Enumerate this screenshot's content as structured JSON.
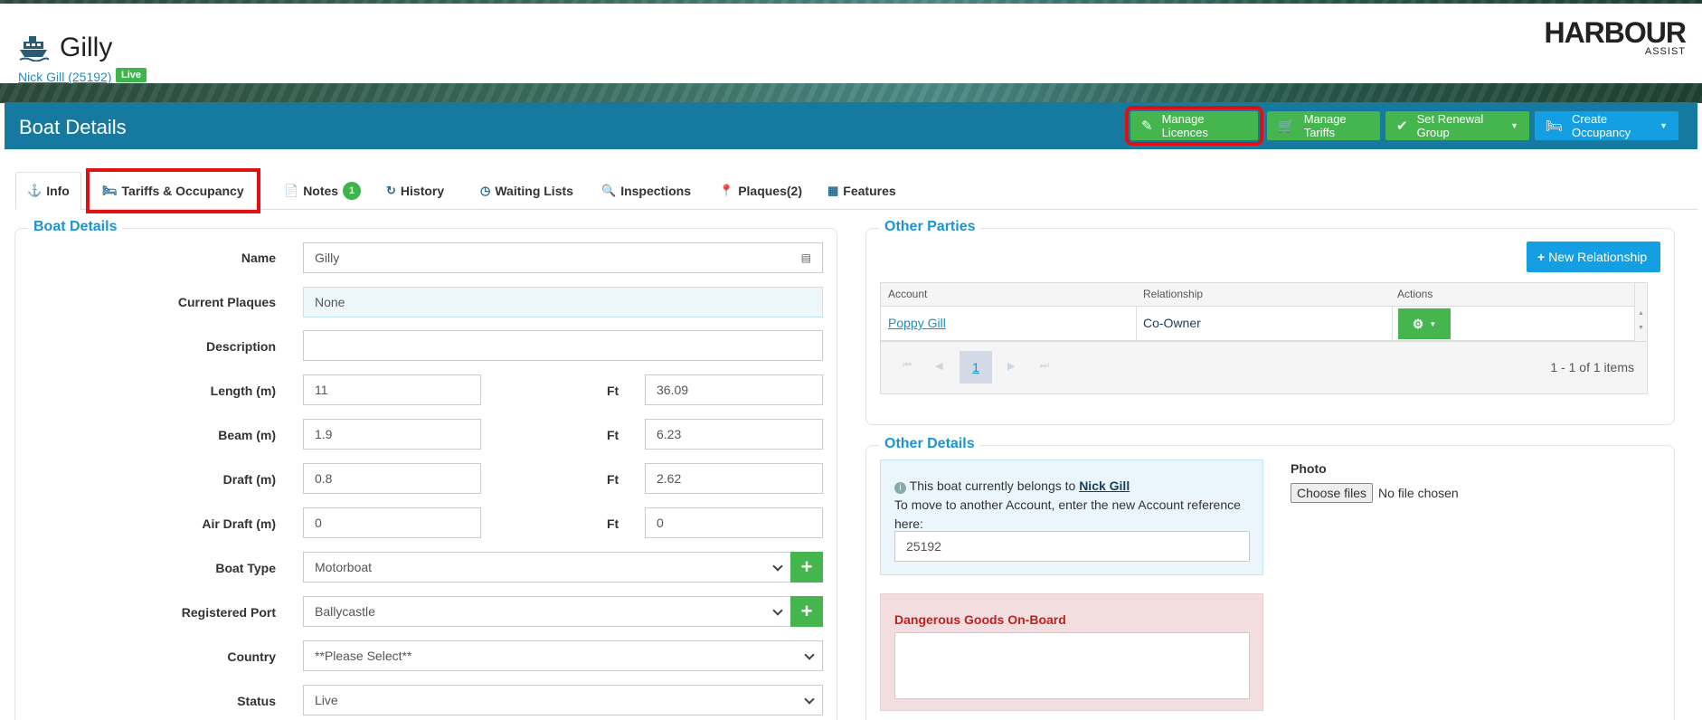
{
  "header": {
    "title": "Gilly",
    "owner_link": "Nick Gill (25192)",
    "status_badge": "Live",
    "logo_main": "HARBOUR",
    "logo_sub": "ASSIST"
  },
  "toolbar": {
    "title": "Boat Details",
    "buttons": [
      {
        "label": "Manage Licences"
      },
      {
        "label": "Manage Tariffs"
      },
      {
        "label": "Set Renewal Group"
      },
      {
        "label": "Create Occupancy"
      }
    ]
  },
  "tabs": [
    {
      "label": "Info"
    },
    {
      "label": "Tariffs & Occupancy"
    },
    {
      "label": "Notes",
      "count": "1"
    },
    {
      "label": "History"
    },
    {
      "label": "Waiting Lists"
    },
    {
      "label": "Inspections"
    },
    {
      "label": "Plaques(2)"
    },
    {
      "label": "Features"
    }
  ],
  "boat_details": {
    "legend": "Boat Details",
    "name_label": "Name",
    "name_value": "Gilly",
    "plaques_label": "Current Plaques",
    "plaques_value": "None",
    "description_label": "Description",
    "description_value": "",
    "length_label": "Length (m)",
    "length_m": "11",
    "length_ft": "36.09",
    "beam_label": "Beam (m)",
    "beam_m": "1.9",
    "beam_ft": "6.23",
    "draft_label": "Draft (m)",
    "draft_m": "0.8",
    "draft_ft": "2.62",
    "air_draft_label": "Air Draft (m)",
    "air_draft_m": "0",
    "air_draft_ft": "0",
    "ft_label": "Ft",
    "boat_type_label": "Boat Type",
    "boat_type_value": "Motorboat",
    "port_label": "Registered Port",
    "port_value": "Ballycastle",
    "country_label": "Country",
    "country_value": "**Please Select**",
    "status_label": "Status",
    "status_value": "Live"
  },
  "other_parties": {
    "legend": "Other Parties",
    "new_button": "New Relationship",
    "columns": [
      "Account",
      "Relationship",
      "Actions"
    ],
    "rows": [
      {
        "account": "Poppy Gill",
        "relationship": "Co-Owner"
      }
    ],
    "page_number": "1",
    "items_summary": "1 - 1 of 1 items"
  },
  "other_details": {
    "legend": "Other Details",
    "belongs_text": "This boat currently belongs to",
    "belongs_name": "Nick Gill",
    "move_text": "To move to another Account, enter the new Account reference here:",
    "account_ref": "25192",
    "photo_label": "Photo",
    "choose_files": "Choose files",
    "no_file": "No file chosen",
    "dangerous_label": "Dangerous Goods On-Board"
  },
  "colors": {
    "bar": "#1679a0",
    "green": "#45b54e",
    "blue": "#139fe2",
    "accent": "#1c93d2"
  }
}
